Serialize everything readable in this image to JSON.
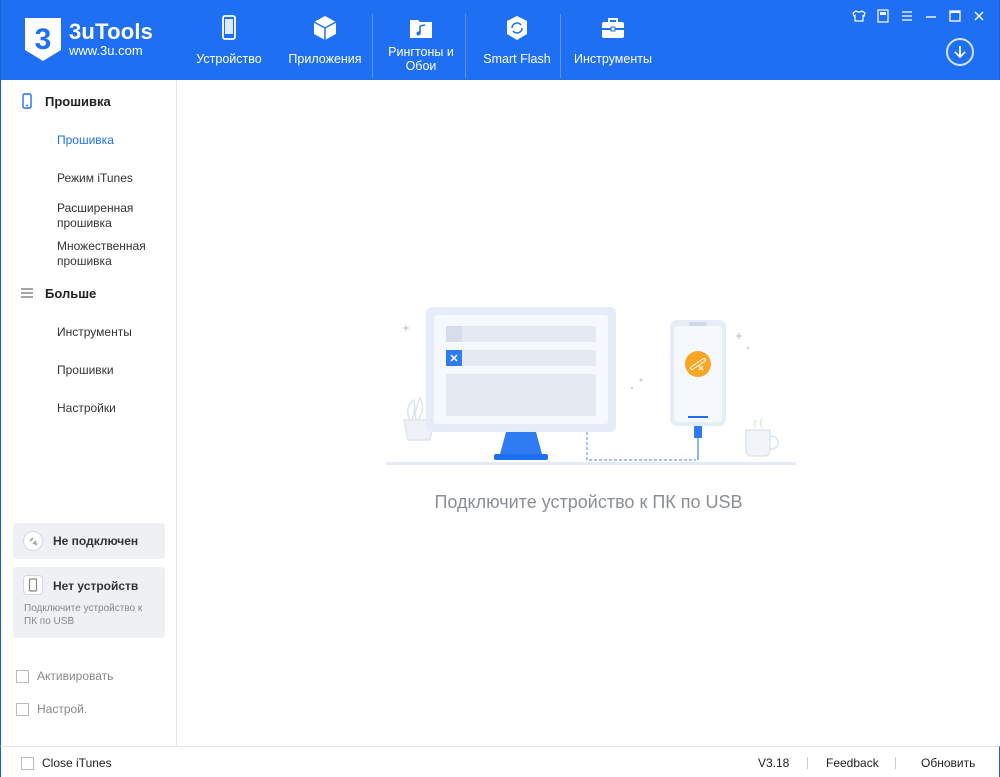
{
  "app": {
    "logo_title": "3uTools",
    "logo_subtitle": "www.3u.com",
    "brand_color": "#1f6ff2"
  },
  "nav": {
    "items": [
      {
        "label": "Устройство",
        "icon": "phone-icon"
      },
      {
        "label": "Приложения",
        "icon": "cube-icon"
      },
      {
        "label": "Рингтоны и Обои",
        "icon": "music-folder-icon"
      },
      {
        "label": "Smart Flash",
        "icon": "flash-shield-icon"
      },
      {
        "label": "Инструменты",
        "icon": "toolbox-icon"
      }
    ]
  },
  "window_controls": [
    "shirt-icon",
    "note-icon",
    "menu-icon",
    "minimize-icon",
    "maximize-icon",
    "close-icon"
  ],
  "sidebar": {
    "section1_title": "Прошивка",
    "section1_items": [
      "Прошивка",
      "Режим iTunes",
      "Расширенная прошивка",
      "Множественная прошивка"
    ],
    "section2_title": "Больше",
    "section2_items": [
      "Инструменты",
      "Прошивки",
      "Настройки"
    ],
    "status_connection": "Не подключен",
    "status_device_title": "Нет устройств",
    "status_device_desc": "Подключите устройство к ПК по USB",
    "checkbox_activate": "Активировать",
    "checkbox_settings": "Настрой."
  },
  "main": {
    "connect_message": "Подключите устройство к ПК по USB"
  },
  "bottom": {
    "close_itunes": "Close iTunes",
    "version": "V3.18",
    "feedback": "Feedback",
    "update": "Обновить"
  }
}
